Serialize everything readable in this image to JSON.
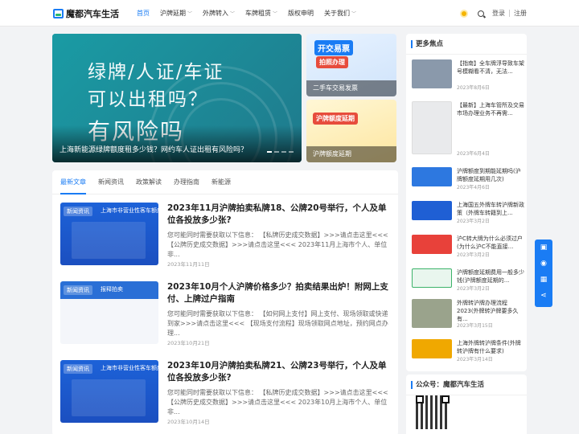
{
  "header": {
    "logo_text": "魔都汽车生活",
    "nav": [
      {
        "label": "首页",
        "active": true,
        "dropdown": false
      },
      {
        "label": "沪牌延期",
        "active": false,
        "dropdown": true
      },
      {
        "label": "外牌转入",
        "active": false,
        "dropdown": true
      },
      {
        "label": "车牌租赁",
        "active": false,
        "dropdown": true
      },
      {
        "label": "版权申明",
        "active": false,
        "dropdown": false
      },
      {
        "label": "关于我们",
        "active": false,
        "dropdown": true
      }
    ],
    "login": "登录",
    "register": "注册"
  },
  "hero": {
    "big_text_1": "绿牌/人证/车证",
    "big_text_2": "可以出租吗？",
    "big_text_3": "有风险吗",
    "title": "上海新能源绿牌额度租多少钱？网约车人证出租有风险吗？"
  },
  "side_banners": [
    {
      "title": "二手车交易发票",
      "badge": "开交易票",
      "badge2": "拍照办理"
    },
    {
      "title": "沪牌额度延期",
      "badge": "沪牌额度延期"
    }
  ],
  "tabs": [
    "最新文章",
    "新闻资讯",
    "政策解读",
    "办理指南",
    "新能源"
  ],
  "posts": [
    {
      "tag": "新闻资讯",
      "thumb_heading": "上海市非营业性客车额度拍",
      "title": "2023年11月沪牌拍卖私牌18、公牌20号举行，个人及单位各投放多少张?",
      "excerpt": "您可能同时需要获取以下信息： 【私牌历史成交数据】>>>请点击这里<<< 【公牌历史成交数据】>>>请点击这里<<< 2023年11月上海市个人、单位非...",
      "date": "2023年11月11日"
    },
    {
      "tag": "新闻资讯",
      "thumb_heading": "报释拍卖",
      "title": "2023年10月个人沪牌价格多少？拍卖结果出炉！附网上支付、上牌过户指南",
      "excerpt": "您可能同时需要获取以下信息： 【如何网上支付】网上支付、现场领取或快递到家>>>请点击这里<<< 【现场支付流程】现场领取网点地址，预约网点办理...",
      "date": "2023年10月21日"
    },
    {
      "tag": "新闻资讯",
      "thumb_heading": "上海市非营业性客车额度拍",
      "title": "2023年10月沪牌拍卖私牌21、公牌23号举行，个人及单位各投放多少张?",
      "excerpt": "您可能同时需要获取以下信息： 【私牌历史成交数据】>>>请点击这里<<< 【公牌历史成交数据】>>>请点击这里<<< 2023年10月上海市个人、单位非...",
      "date": "2023年10月14日"
    }
  ],
  "sidebar": {
    "heading": "更多焦点",
    "items": [
      {
        "title": "【指南】全车牌浮导致车架号模糊看不清，无法...",
        "date": "2023年8月6日"
      },
      {
        "title": "【最新】上海车管所及交易市场办理业务不再需...",
        "date": "2023年6月4日"
      },
      {
        "title": "沪牌额度到期能延期吗(沪牌额度延期用几次)",
        "date": "2023年4月6日"
      },
      {
        "title": "上海国五外牌车转沪牌新政策（外牌车转籍到上...",
        "date": "2023年3月2日"
      },
      {
        "title": "沪C转大牌为什么必须过户(为什么沪C不能直接...",
        "date": "2023年3月2日"
      },
      {
        "title": "沪牌额度延期费用一般多少钱(沪牌额度延期的...",
        "date": "2023年3月2日"
      },
      {
        "title": "外牌转沪牌办理流程2023(外牌转沪牌要多久 有...",
        "date": "2023年3月15日"
      },
      {
        "title": "上海外牌转沪牌条件(外牌转沪牌有什么要求)",
        "date": "2023年3月14日"
      }
    ],
    "wechat_heading": "公众号：魔都汽车生活"
  },
  "colors": {
    "accent": "#1a7cf4",
    "hero": "#1e8e9a"
  }
}
